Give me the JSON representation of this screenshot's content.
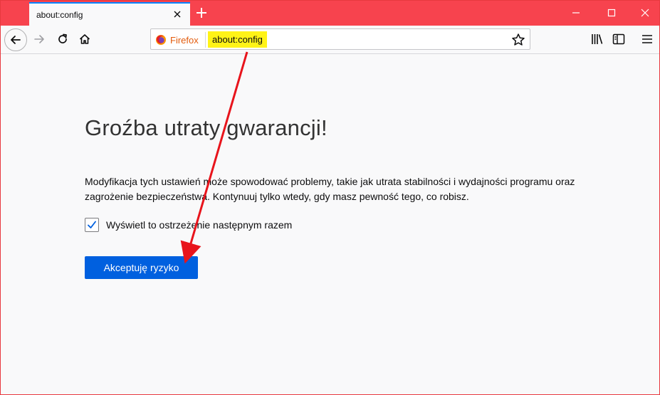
{
  "tab": {
    "title": "about:config"
  },
  "urlbar": {
    "identity_label": "Firefox",
    "url": "about:config"
  },
  "content": {
    "heading": "Groźba utraty gwarancji!",
    "warning_text": "Modyfikacja tych ustawień może spowodować problemy, takie jak utrata stabilności i wydajności programu oraz zagrożenie bezpieczeństwa. Kontynuuj tylko wtedy, gdy masz pewność tego, co robisz.",
    "checkbox_label": "Wyświetl to ostrzeżenie następnym razem",
    "checkbox_checked": true,
    "accept_button": "Akceptuję ryzyko"
  },
  "colors": {
    "titlebar": "#f7434e",
    "accent": "#0060df",
    "annotation": "#e8141c",
    "highlight": "#fff317"
  }
}
